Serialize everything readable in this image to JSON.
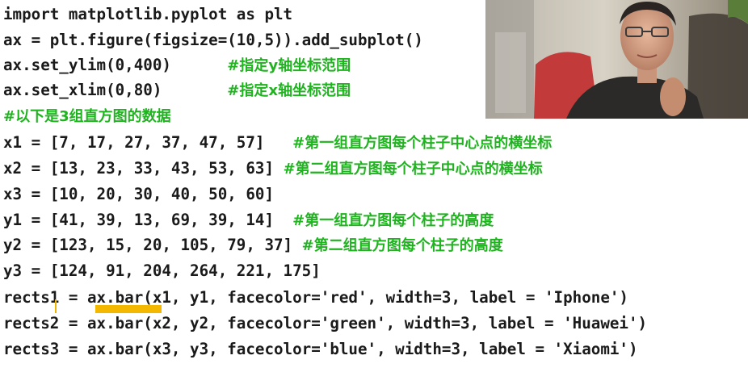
{
  "code_lines": [
    {
      "code": "import matplotlib.pyplot as plt",
      "comment": ""
    },
    {
      "code": "ax = plt.figure(figsize=(10,5)).add_subplot()",
      "comment": ""
    },
    {
      "code": "ax.set_ylim(0,400)      ",
      "comment": "#指定y轴坐标范围"
    },
    {
      "code": "ax.set_xlim(0,80)       ",
      "comment": "#指定x轴坐标范围"
    },
    {
      "code": "",
      "comment": "#以下是3组直方图的数据"
    },
    {
      "code": "x1 = [7, 17, 27, 37, 47, 57]   ",
      "comment": "#第一组直方图每个柱子中心点的横坐标"
    },
    {
      "code": "x2 = [13, 23, 33, 43, 53, 63] ",
      "comment": "#第二组直方图每个柱子中心点的横坐标"
    },
    {
      "code": "x3 = [10, 20, 30, 40, 50, 60]",
      "comment": ""
    },
    {
      "code": "y1 = [41, 39, 13, 69, 39, 14]  ",
      "comment": "#第一组直方图每个柱子的高度"
    },
    {
      "code": "y2 = [123, 15, 20, 105, 79, 37] ",
      "comment": "#第二组直方图每个柱子的高度"
    },
    {
      "code": "y3 = [124, 91, 204, 264, 221, 175]",
      "comment": ""
    },
    {
      "code": "rects1 = ax.bar(x1, y1, facecolor='red', width=3, label = 'Iphone')",
      "comment": ""
    },
    {
      "code": "rects2 = ax.bar(x2, y2, facecolor='green', width=3, label = 'Huawei')",
      "comment": ""
    },
    {
      "code": "rects3 = ax.bar(x3, y3, facecolor='blue', width=3, label = 'Xiaomi')",
      "comment": ""
    }
  ],
  "colors": {
    "code": "#1a1a1a",
    "comment": "#1fb31f",
    "highlight": "#f5b800",
    "background": "#ffffff"
  }
}
